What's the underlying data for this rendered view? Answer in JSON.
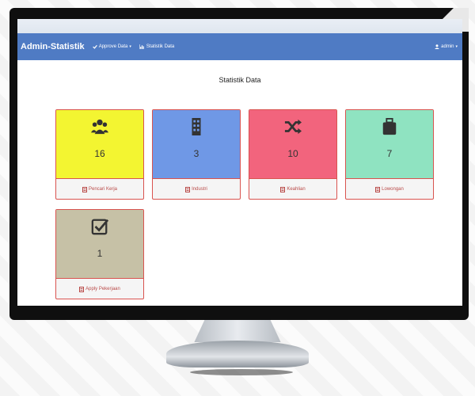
{
  "app": {
    "brand": "Admin-Statistik",
    "nav": [
      {
        "label": "Approve Data",
        "icon": "check-icon",
        "dropdown": true
      },
      {
        "label": "Statistik Data",
        "icon": "bar-chart-icon",
        "dropdown": false
      }
    ],
    "user": {
      "label": "admin",
      "icon": "user-icon",
      "dropdown": true
    }
  },
  "page": {
    "title": "Statistik Data"
  },
  "cards": [
    {
      "label": "Pencari Kerja",
      "count": "16",
      "icon": "users-icon",
      "color": "#f3f531"
    },
    {
      "label": "Industri",
      "count": "3",
      "icon": "building-icon",
      "color": "#6f98e6"
    },
    {
      "label": "Keahlian",
      "count": "10",
      "icon": "shuffle-icon",
      "color": "#f2647d"
    },
    {
      "label": "Lowongan",
      "count": "7",
      "icon": "briefcase-icon",
      "color": "#8fe3c1"
    },
    {
      "label": "Apply Pekerjaan",
      "count": "1",
      "icon": "checkbox-icon",
      "color": "#c6c1a6"
    }
  ],
  "accent": "#d9534f",
  "navbar_color": "#4f7bc4"
}
